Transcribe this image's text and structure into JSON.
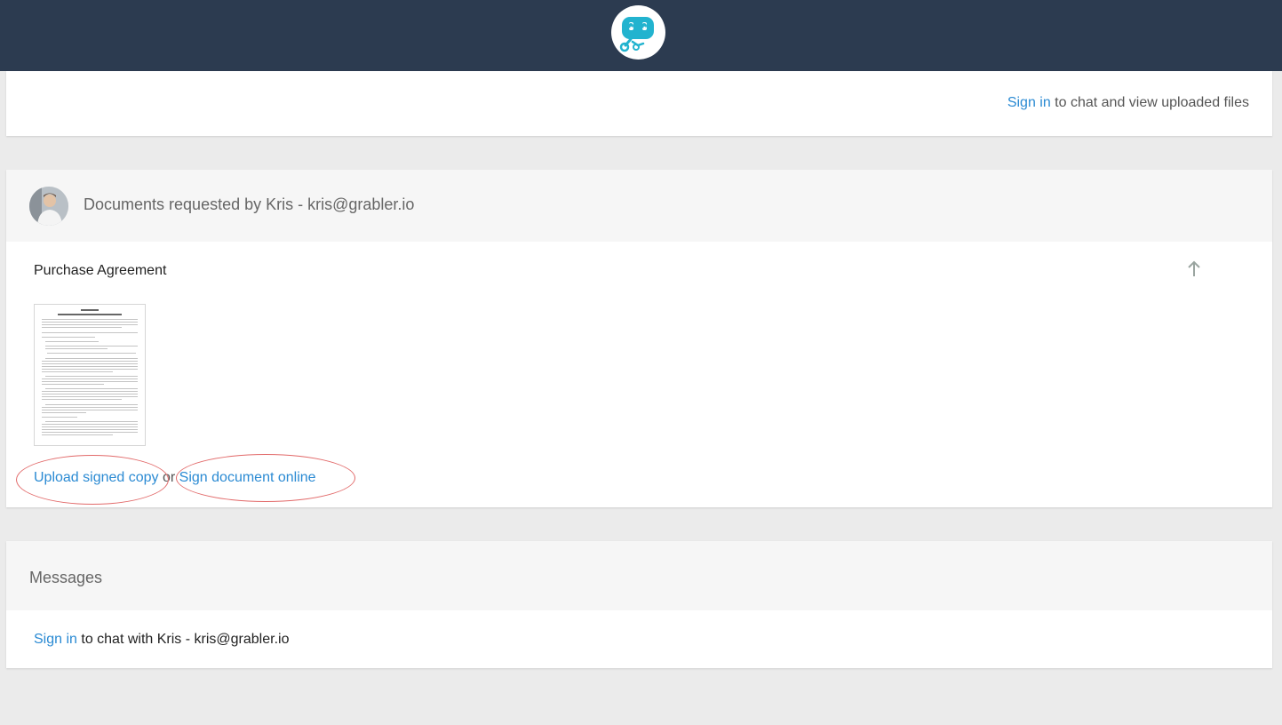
{
  "header": {
    "logo_icon": "robot-chat-icon",
    "bg_color": "#2c3b50",
    "logo_color": "#22b3cf"
  },
  "top_card": {
    "signin_link": "Sign in",
    "signin_suffix": " to chat and view uploaded files"
  },
  "documents": {
    "title": "Documents requested by Kris - kris@grabler.io",
    "avatar_icon": "user-avatar",
    "document": {
      "name": "Purchase Agreement",
      "thumbnail_icon": "document-thumbnail",
      "collapse_icon": "arrow-up-icon",
      "upload_label": "Upload signed copy",
      "or_text": " or ",
      "sign_label": "Sign document online"
    }
  },
  "messages": {
    "title": "Messages",
    "signin_link": "Sign in",
    "signin_suffix": " to chat with Kris - kris@grabler.io"
  },
  "colors": {
    "link": "#2a8ad3",
    "annotation_circle": "#e26a6a",
    "page_bg": "#ebebeb"
  }
}
